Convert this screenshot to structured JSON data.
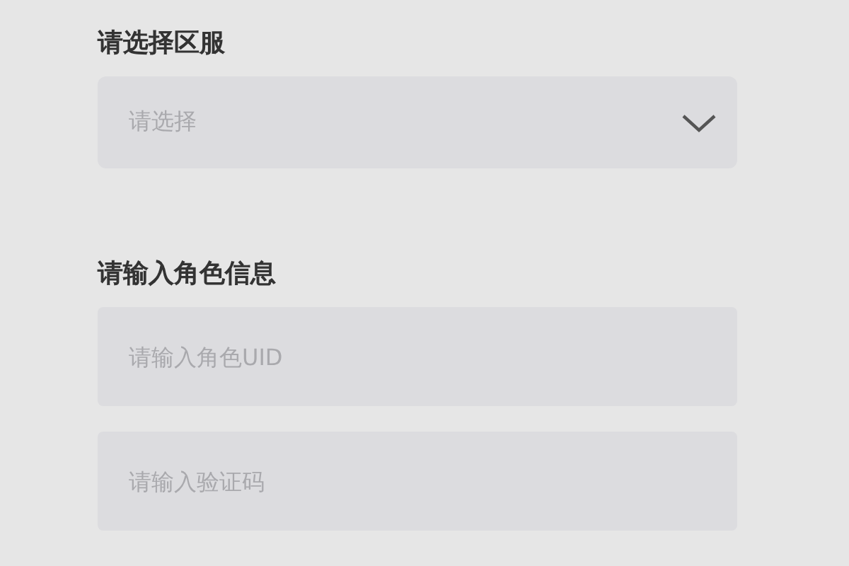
{
  "server_section": {
    "label": "请选择区服",
    "select": {
      "placeholder": "请选择"
    }
  },
  "role_section": {
    "label": "请输入角色信息",
    "fields": [
      {
        "placeholder": "请输入角色UID"
      },
      {
        "placeholder": "请输入验证码"
      }
    ]
  }
}
